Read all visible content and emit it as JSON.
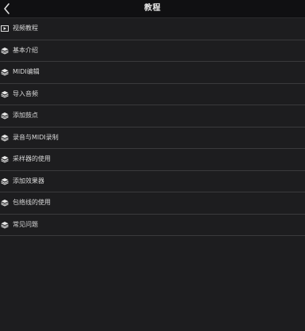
{
  "header": {
    "title": "教程"
  },
  "menu": {
    "items": [
      {
        "label": "视频教程",
        "icon": "video-play-icon"
      },
      {
        "label": "基本介绍",
        "icon": "layers-icon"
      },
      {
        "label": "MIDI编辑",
        "icon": "layers-icon"
      },
      {
        "label": "导入音频",
        "icon": "layers-icon"
      },
      {
        "label": "添加鼓点",
        "icon": "layers-icon"
      },
      {
        "label": "录音与MIDI录制",
        "icon": "layers-icon"
      },
      {
        "label": "采样器的使用",
        "icon": "layers-icon"
      },
      {
        "label": "添加效果器",
        "icon": "layers-icon"
      },
      {
        "label": "包络线的使用",
        "icon": "layers-icon"
      },
      {
        "label": "常见问题",
        "icon": "layers-icon"
      }
    ]
  },
  "colors": {
    "background": "#1d1d1f",
    "header_background": "#101012",
    "divider": "#3a3a3c",
    "text": "#d8d8d8"
  }
}
